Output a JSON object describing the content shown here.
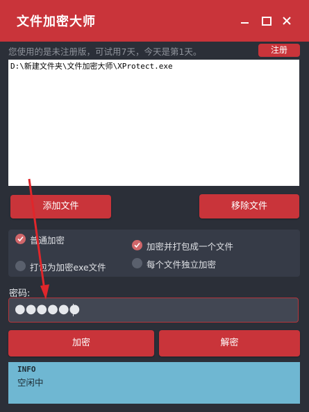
{
  "window": {
    "title": "文件加密大师",
    "controls": {
      "minimize": "minimize-icon",
      "maximize": "maximize-icon",
      "close": "close-icon"
    }
  },
  "trial_notice": "您使用的是未注册版，可试用7天，今天是第1天。",
  "register_label": "注册",
  "file_list": {
    "items": [
      "D:\\新建文件夹\\文件加密大师\\XProtect.exe"
    ]
  },
  "buttons": {
    "add_file": "添加文件",
    "remove_file": "移除文件",
    "encrypt": "加密",
    "decrypt": "解密"
  },
  "options": {
    "normal_encrypt": {
      "label": "普通加密",
      "checked": true
    },
    "pack_as_exe": {
      "label": "打包为加密exe文件",
      "checked": false
    },
    "pack_into_one": {
      "label": "加密并打包成一个文件",
      "checked": true
    },
    "each_file_separate": {
      "label": "每个文件独立加密",
      "checked": false
    }
  },
  "password": {
    "label": "密码:",
    "masked_value": "●●●●●●"
  },
  "info": {
    "title": "INFO",
    "status": "空闲中"
  },
  "colors": {
    "accent": "#c9343a",
    "background": "#2b2f38",
    "panel": "#363b47",
    "info_panel": "#6fb7d2",
    "annotation_arrow": "#e0262b"
  }
}
